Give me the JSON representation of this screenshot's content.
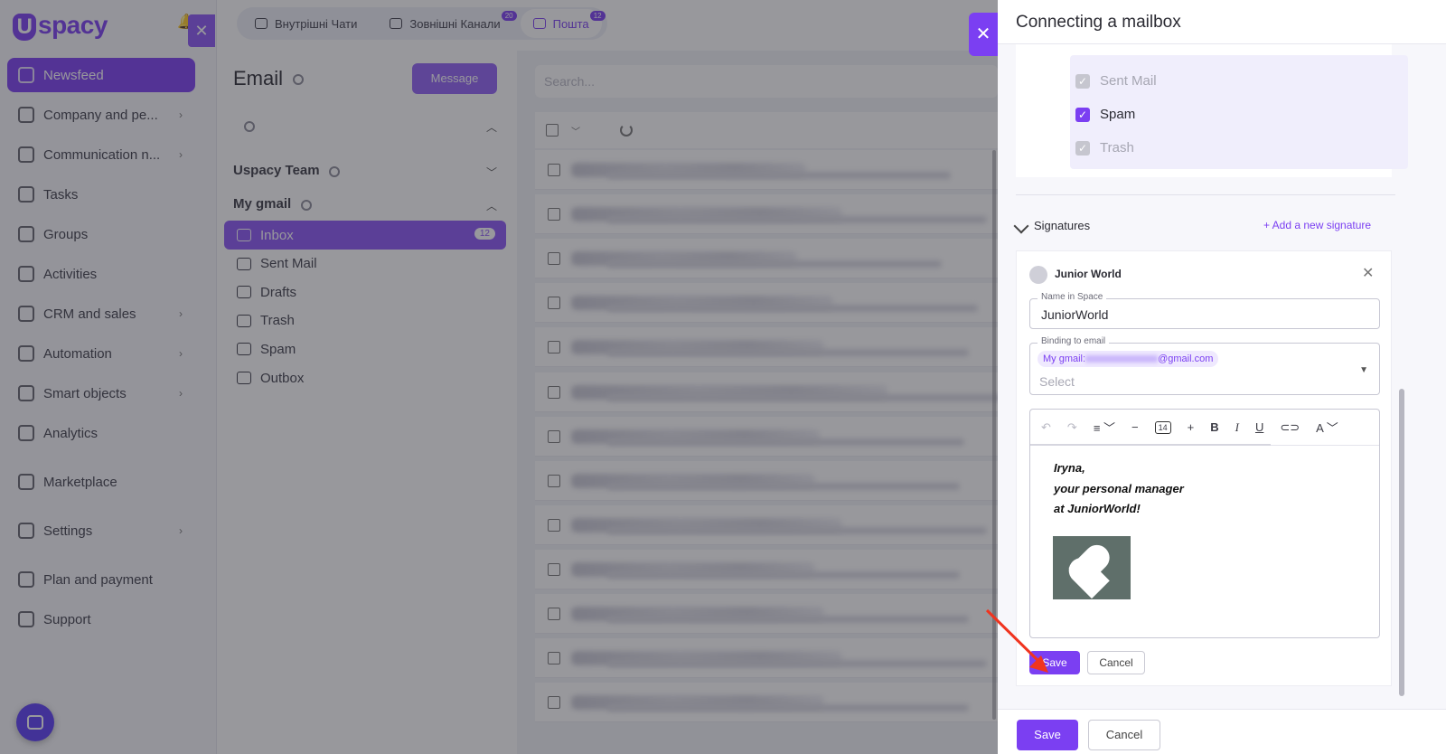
{
  "sidebar": {
    "logo": "spacy",
    "logo_mark": "U",
    "items": [
      {
        "label": "Newsfeed",
        "active": true,
        "chevron": false
      },
      {
        "label": "Company and pe...",
        "chevron": true
      },
      {
        "label": "Communication n...",
        "chevron": true
      },
      {
        "label": "Tasks",
        "chevron": false
      },
      {
        "label": "Groups",
        "chevron": false
      },
      {
        "label": "Activities",
        "chevron": false
      },
      {
        "label": "CRM and sales",
        "chevron": true
      },
      {
        "label": "Automation",
        "chevron": true
      },
      {
        "label": "Smart objects",
        "chevron": true
      },
      {
        "label": "Analytics",
        "chevron": false
      },
      {
        "label": "Marketplace",
        "chevron": false
      },
      {
        "label": "Settings",
        "chevron": true
      },
      {
        "label": "Plan and payment",
        "chevron": false
      },
      {
        "label": "Support",
        "chevron": false
      }
    ]
  },
  "top_tabs": [
    {
      "label": "Внутрішні Чати",
      "badge": ""
    },
    {
      "label": "Зовнішні Канали",
      "badge": "20"
    },
    {
      "label": "Пошта",
      "badge": "12",
      "active": true
    }
  ],
  "email_panel": {
    "title": "Email",
    "message_button": "Message",
    "accounts": [
      {
        "name": "Uspacy Team",
        "expanded": false
      },
      {
        "name": "My gmail",
        "expanded": true
      }
    ],
    "folders": [
      {
        "label": "Inbox",
        "badge": "12",
        "active": true
      },
      {
        "label": "Sent Mail"
      },
      {
        "label": "Drafts"
      },
      {
        "label": "Trash"
      },
      {
        "label": "Spam"
      },
      {
        "label": "Outbox"
      }
    ],
    "search_placeholder": "Search..."
  },
  "drawer": {
    "title": "Connecting a mailbox",
    "folder_checks": [
      {
        "label": "Sent Mail",
        "checked": true,
        "disabled": true
      },
      {
        "label": "Spam",
        "checked": true,
        "disabled": false
      },
      {
        "label": "Trash",
        "checked": true,
        "disabled": true
      }
    ],
    "signatures_label": "Signatures",
    "add_signature": "+ Add a new signature",
    "signature": {
      "name": "Junior World",
      "name_in_space_label": "Name in Space",
      "name_in_space_value": "JuniorWorld",
      "binding_label": "Binding to email",
      "binding_chip_prefix": "My gmail:",
      "binding_chip_suffix": "@gmail.com",
      "binding_placeholder": "Select",
      "font_size": "14",
      "body_lines": [
        "Iryna,",
        "your personal manager",
        "at JuniorWorld!"
      ],
      "save": "Save",
      "cancel": "Cancel"
    },
    "footer_save": "Save",
    "footer_cancel": "Cancel"
  },
  "colors": {
    "accent": "#7b3ff2",
    "annotation_arrow": "#f0341f"
  }
}
